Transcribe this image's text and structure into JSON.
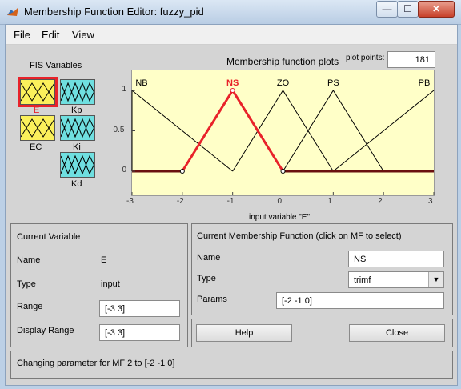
{
  "window": {
    "title": "Membership Function Editor: fuzzy_pid",
    "btn_min": "—",
    "btn_max": "☐",
    "btn_close": "✕"
  },
  "menu": [
    "File",
    "Edit",
    "View"
  ],
  "fis": {
    "heading": "FIS Variables",
    "inputs": [
      {
        "name": "E",
        "selected": true
      },
      {
        "name": "EC",
        "selected": false
      }
    ],
    "outputs": [
      {
        "name": "Kp"
      },
      {
        "name": "Ki"
      },
      {
        "name": "Kd"
      }
    ]
  },
  "plot": {
    "title": "Membership function plots",
    "points_label": "plot points:",
    "points_value": "181",
    "xlabel": "input variable \"E\"",
    "selected_color": "#e8222a"
  },
  "chart_data": {
    "type": "line",
    "xlim": [
      -3,
      3
    ],
    "ylim": [
      0,
      1
    ],
    "xticks": [
      "-3",
      "-2",
      "-1",
      "0",
      "1",
      "2",
      "3"
    ],
    "yticks": [
      "0",
      "0.5",
      "1"
    ],
    "series": [
      {
        "name": "NB",
        "x": [
          -3,
          -3,
          -1
        ],
        "y": [
          0,
          1,
          0
        ],
        "selected": false
      },
      {
        "name": "NS",
        "x": [
          -2,
          -1,
          0
        ],
        "y": [
          0,
          1,
          0
        ],
        "selected": true
      },
      {
        "name": "ZO",
        "x": [
          -1,
          0,
          1
        ],
        "y": [
          0,
          1,
          0
        ],
        "selected": false
      },
      {
        "name": "PS",
        "x": [
          0,
          1,
          2
        ],
        "y": [
          0,
          1,
          0
        ],
        "selected": false
      },
      {
        "name": "PB",
        "x": [
          1,
          3,
          3
        ],
        "y": [
          0,
          1,
          1
        ],
        "selected": false
      }
    ]
  },
  "current_variable": {
    "heading": "Current Variable",
    "name_label": "Name",
    "name_value": "E",
    "type_label": "Type",
    "type_value": "input",
    "range_label": "Range",
    "range_value": "[-3 3]",
    "display_range_label": "Display Range",
    "display_range_value": "[-3 3]"
  },
  "current_mf": {
    "heading": "Current Membership Function (click on MF to select)",
    "name_label": "Name",
    "name_value": "NS",
    "type_label": "Type",
    "type_value": "trimf",
    "params_label": "Params",
    "params_value": "[-2 -1 0]"
  },
  "buttons": {
    "help": "Help",
    "close": "Close"
  },
  "status": "Changing parameter for MF 2 to  [-2 -1 0]"
}
